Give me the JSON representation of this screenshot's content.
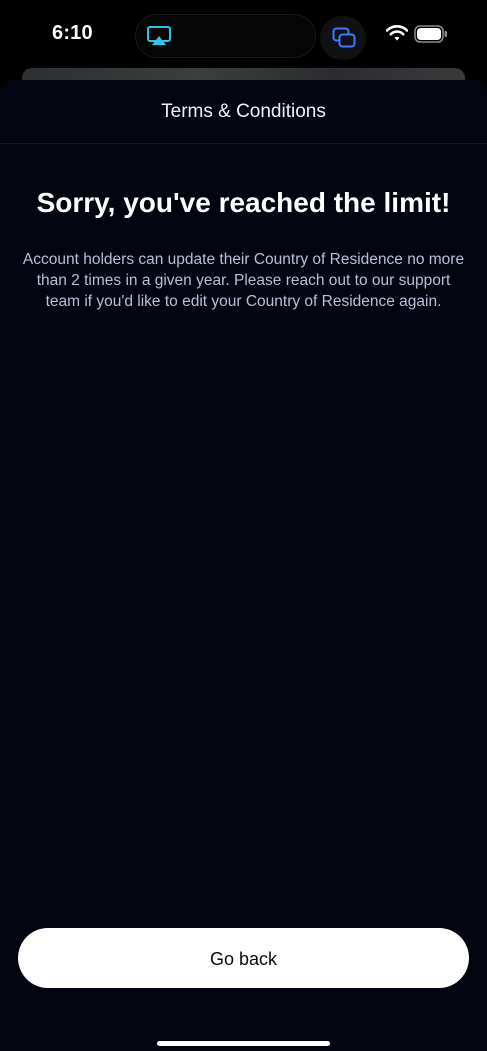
{
  "status_bar": {
    "time": "6:10",
    "icons": [
      "airplay-icon",
      "screen-mirror-icon",
      "wifi-icon",
      "battery-icon"
    ],
    "airplay_color": "#2ec4e8",
    "mirror_color": "#3a7bff"
  },
  "sheet": {
    "title": "Terms & Conditions",
    "heading": "Sorry, you've reached the limit!",
    "body": "Account holders can update their Country of Residence no more than 2 times in a given year. Please reach out to our support team if you'd like to edit your Country of Residence again.",
    "background": "#02040f"
  },
  "actions": {
    "go_back_label": "Go back"
  }
}
